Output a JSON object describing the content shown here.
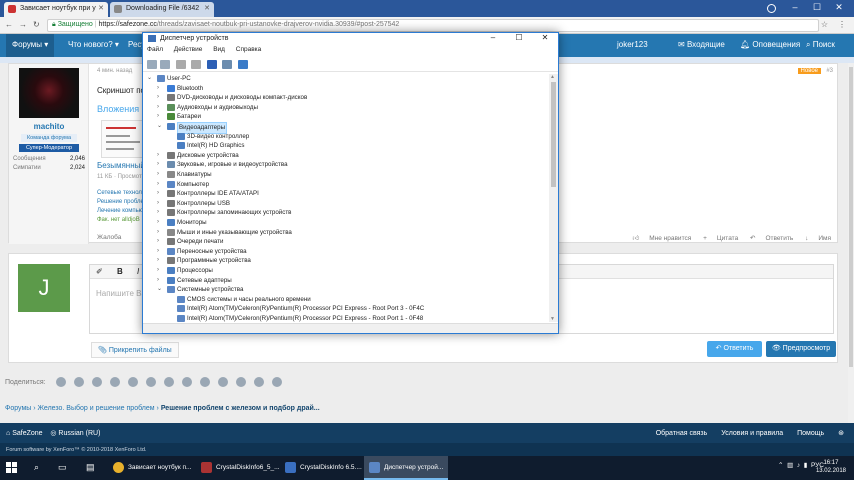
{
  "browser": {
    "tabs": [
      {
        "label": "Зависает ноутбук при у",
        "active": true
      },
      {
        "label": "Downloading File /6342",
        "active": false
      }
    ],
    "url": {
      "secure_label": "Защищено",
      "host": "https://safezone.cc",
      "path": "/threads/zavisaet-noutbuk-pri-ustanovke-drajverov-nvidia.30939/#post-257542"
    }
  },
  "forum_nav": {
    "items": [
      "Форумы",
      "Что нового?",
      "Ресурсы"
    ],
    "user": "joker123",
    "inbox": "Входящие",
    "alerts": "Оповещения",
    "search": "Поиск"
  },
  "post": {
    "date": "4 мин. назад",
    "new_badge": "Новое",
    "number": "#3",
    "user": {
      "name": "machito",
      "title": "Команда форума",
      "role": "Супер-Модератор",
      "stats": [
        {
          "label": "Сообщения",
          "value": "2,046"
        },
        {
          "label": "Симпатии",
          "value": "2,024"
        }
      ]
    },
    "text": "Скриншот пока",
    "attachments_heading": "Вложения",
    "file_name": "Безымянный.p",
    "file_meta": "11 КБ · Просмотр",
    "links": [
      "Сетевые технолог",
      "Решение проблем",
      "Лечение компьют",
      "Фак. нет alldjoB"
    ],
    "complaint": "Жалоба",
    "actions": [
      "Мне нравится",
      "Цитата",
      "Ответить",
      "Имя"
    ]
  },
  "reply": {
    "avatar_letter": "J",
    "toolbar": [
      "B",
      "I"
    ],
    "placeholder": "Напишите Ва",
    "attach": "Прикрепить файлы",
    "reply_button": "Ответить",
    "preview_button": "Предпросмотр"
  },
  "share_label": "Поделиться:",
  "breadcrumbs": [
    "Форумы",
    "Железо. Выбор и решение проблем",
    "Решение проблем с железом и подбор драй..."
  ],
  "footer": {
    "brand": "SafeZone",
    "language": "Russian (RU)",
    "links": [
      "Обратная связь",
      "Условия и правила",
      "Помощь"
    ],
    "copyright": "Forum software by XenForo™ © 2010-2018 XenForo Ltd."
  },
  "device_manager": {
    "title": "Диспетчер устройств",
    "menu": [
      "Файл",
      "Действие",
      "Вид",
      "Справка"
    ],
    "root": "User-PC",
    "nodes": [
      {
        "label": "Bluetooth",
        "level": 1,
        "expanded": false
      },
      {
        "label": "DVD-дисководы и дисководы компакт-дисков",
        "level": 1,
        "expanded": false
      },
      {
        "label": "Аудиовходы и аудиовыходы",
        "level": 1,
        "expanded": false
      },
      {
        "label": "Батареи",
        "level": 1,
        "expanded": false
      },
      {
        "label": "Видеоадаптеры",
        "level": 1,
        "expanded": true,
        "selected": true
      },
      {
        "label": "3D-видео контроллер",
        "level": 2
      },
      {
        "label": "Intel(R) HD Graphics",
        "level": 2
      },
      {
        "label": "Дисковые устройства",
        "level": 1,
        "expanded": false
      },
      {
        "label": "Звуковые, игровые и видеоустройства",
        "level": 1,
        "expanded": false
      },
      {
        "label": "Клавиатуры",
        "level": 1,
        "expanded": false
      },
      {
        "label": "Компьютер",
        "level": 1,
        "expanded": false
      },
      {
        "label": "Контроллеры IDE ATA/ATAPI",
        "level": 1,
        "expanded": false
      },
      {
        "label": "Контроллеры USB",
        "level": 1,
        "expanded": false
      },
      {
        "label": "Контроллеры запоминающих устройств",
        "level": 1,
        "expanded": false
      },
      {
        "label": "Мониторы",
        "level": 1,
        "expanded": false
      },
      {
        "label": "Мыши и иные указывающие устройства",
        "level": 1,
        "expanded": false
      },
      {
        "label": "Очереди печати",
        "level": 1,
        "expanded": false
      },
      {
        "label": "Переносные устройства",
        "level": 1,
        "expanded": false
      },
      {
        "label": "Программные устройства",
        "level": 1,
        "expanded": false
      },
      {
        "label": "Процессоры",
        "level": 1,
        "expanded": false
      },
      {
        "label": "Сетевые адаптеры",
        "level": 1,
        "expanded": false
      },
      {
        "label": "Системные устройства",
        "level": 1,
        "expanded": true
      },
      {
        "label": "CMOS системы и часы реального времени",
        "level": 2
      },
      {
        "label": "Intel(R) Atom(TM)/Celeron(R)/Pentium(R) Processor PCI Express - Root Port 3 - 0F4C",
        "level": 2
      },
      {
        "label": "Intel(R) Atom(TM)/Celeron(R)/Pentium(R) Processor PCI Express - Root Port 1 - 0F48",
        "level": 2
      }
    ]
  },
  "taskbar": {
    "items": [
      {
        "label": "Зависает ноутбук п...",
        "active": false
      },
      {
        "label": "CrystalDiskInfo6_5_...",
        "active": false
      },
      {
        "label": "CrystalDiskInfo 6.5....",
        "active": false
      },
      {
        "label": "Диспетчер устрой...",
        "active": true
      }
    ],
    "lang": "РУС",
    "time": "16:17",
    "date": "13.02.2018"
  },
  "colors": {
    "forum_blue": "#2577b1",
    "footer_navy": "#143e62",
    "selection": "#cce8ff"
  }
}
